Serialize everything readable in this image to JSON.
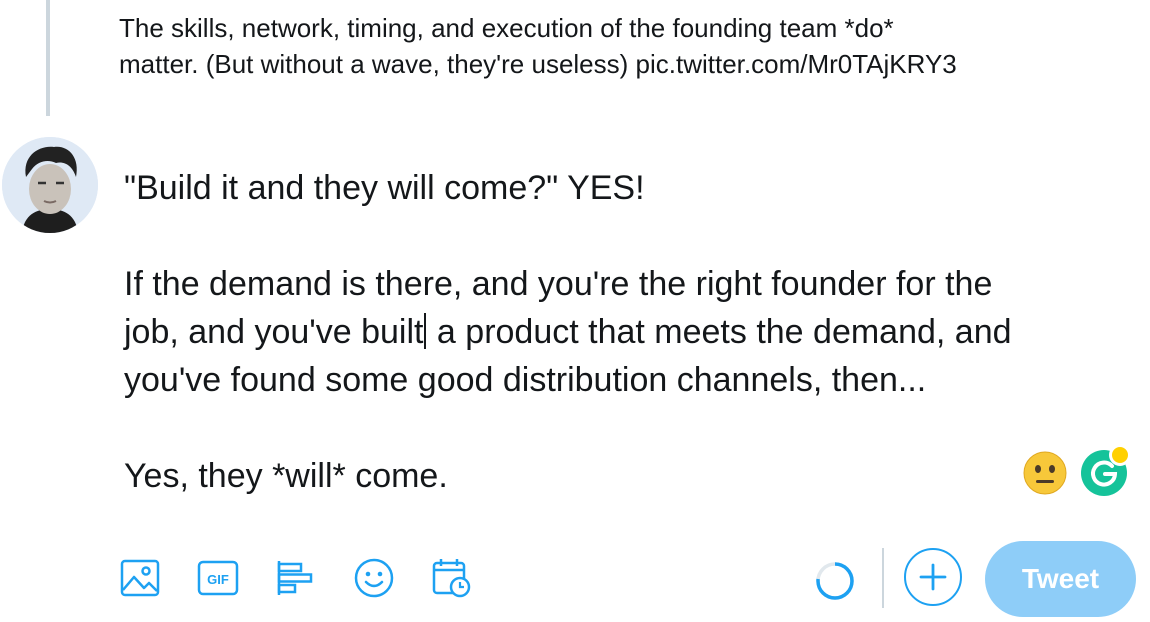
{
  "quoted_tweet": {
    "lines": [
      "The skills, network, timing, and execution of the founding team *do*",
      "matter. (But without a wave, they're useless) pic.twitter.com/Mr0TAjKRY3"
    ]
  },
  "compose": {
    "line1": "\"Build it and they will come?\" YES!",
    "line2": "If the demand is there, and you're the right founder for the",
    "line3_before_cursor": "job, and you've built",
    "line3_after_cursor": " a product that meets the demand, and",
    "line4": "you've found some good distribution channels, then...",
    "line5": "Yes, they *will* come."
  },
  "toolbar": {
    "gif_label": "GIF",
    "icons": [
      "image-icon",
      "gif-icon",
      "poll-icon",
      "emoji-icon",
      "schedule-icon"
    ]
  },
  "actions": {
    "tweet_label": "Tweet"
  },
  "colors": {
    "accent": "#1da1f2",
    "tweet_button_disabled": "#8ecdf8",
    "grammarly": "#15c39a",
    "grammarly_badge": "#ffd000",
    "text": "#14171a",
    "divider": "#ccd6dd"
  }
}
